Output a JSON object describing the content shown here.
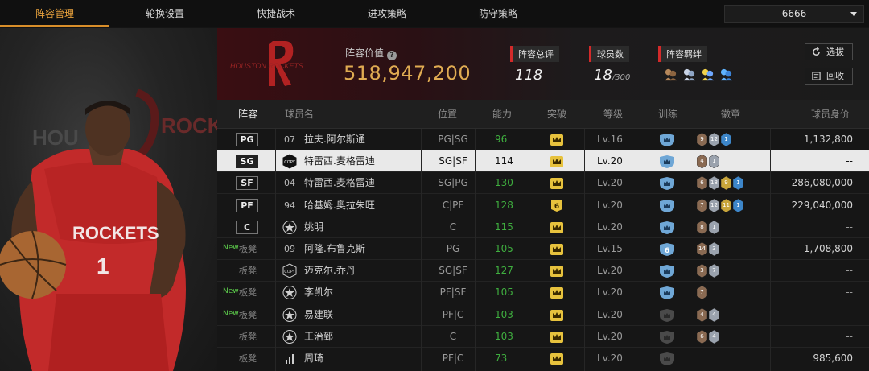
{
  "nav": {
    "tabs": [
      "阵容管理",
      "轮换设置",
      "快捷战术",
      "进攻策略",
      "防守策略"
    ],
    "server": "6666"
  },
  "header": {
    "team_logo_text": "HOUSTON ROCKETS",
    "value_label": "阵容价值",
    "value": "518,947,200",
    "overall_label": "阵容总评",
    "overall": "118",
    "players_label": "球员数",
    "players": "18",
    "players_max": "/300",
    "bonds_label": "阵容羁绊",
    "btn_select": "选拔",
    "btn_recycle": "回收"
  },
  "player_art": {
    "jersey_team": "ROCKETS",
    "jersey_number": "1",
    "bg_text_left": "HOU",
    "bg_text_right": "ROCK"
  },
  "table": {
    "headers": [
      "阵容",
      "球员名",
      "位置",
      "能力",
      "突破",
      "等级",
      "训练",
      "徽章",
      "球员身价"
    ],
    "rows": [
      {
        "slot": "PG",
        "bench": false,
        "new": false,
        "num": "07",
        "icon": "",
        "name": "拉夫.阿尔斯通",
        "pos": "PG|SG",
        "ability": "96",
        "breakthrough": "crown",
        "level": "Lv.16",
        "training": "blue",
        "badges": [
          [
            "9",
            "bronze"
          ],
          [
            "12",
            "silver"
          ],
          [
            "1",
            "blue"
          ]
        ],
        "price": "1,132,800"
      },
      {
        "slot": "SG",
        "bench": false,
        "new": false,
        "num": "",
        "icon": "COPY",
        "name": "特雷西.麦格雷迪",
        "pos": "SG|SF",
        "ability": "114",
        "breakthrough": "crown",
        "level": "Lv.20",
        "training": "blue",
        "badges": [
          [
            "4",
            "bronze"
          ],
          [
            "1",
            "silver"
          ]
        ],
        "price": "--",
        "selected": true
      },
      {
        "slot": "SF",
        "bench": false,
        "new": false,
        "num": "04",
        "icon": "",
        "name": "特雷西.麦格雷迪",
        "pos": "SG|PG",
        "ability": "130",
        "breakthrough": "crown",
        "level": "Lv.20",
        "training": "blue",
        "badges": [
          [
            "6",
            "bronze"
          ],
          [
            "18",
            "silver"
          ],
          [
            "9",
            "gold"
          ],
          [
            "1",
            "blue"
          ]
        ],
        "price": "286,080,000"
      },
      {
        "slot": "PF",
        "bench": false,
        "new": false,
        "num": "94",
        "icon": "",
        "name": "哈基姆.奥拉朱旺",
        "pos": "C|PF",
        "ability": "128",
        "breakthrough": "6",
        "level": "Lv.20",
        "training": "blue",
        "badges": [
          [
            "7",
            "bronze"
          ],
          [
            "12",
            "silver"
          ],
          [
            "11",
            "gold"
          ],
          [
            "1",
            "blue"
          ]
        ],
        "price": "229,040,000"
      },
      {
        "slot": "C",
        "bench": false,
        "new": false,
        "num": "",
        "icon": "star",
        "name": "姚明",
        "pos": "C",
        "ability": "115",
        "breakthrough": "crown",
        "level": "Lv.20",
        "training": "blue",
        "badges": [
          [
            "8",
            "bronze"
          ],
          [
            "1",
            "silver"
          ]
        ],
        "price": "--"
      },
      {
        "slot": "板凳",
        "bench": true,
        "new": true,
        "num": "09",
        "icon": "",
        "name": "阿隆.布鲁克斯",
        "pos": "PG",
        "ability": "105",
        "breakthrough": "crown",
        "level": "Lv.15",
        "training": "6",
        "badges": [
          [
            "14",
            "bronze"
          ],
          [
            "3",
            "silver"
          ]
        ],
        "price": "1,708,800"
      },
      {
        "slot": "板凳",
        "bench": true,
        "new": false,
        "num": "",
        "icon": "COPY",
        "name": "迈克尔.乔丹",
        "pos": "SG|SF",
        "ability": "127",
        "breakthrough": "crown",
        "level": "Lv.20",
        "training": "blue",
        "badges": [
          [
            "3",
            "bronze"
          ],
          [
            "7",
            "silver"
          ]
        ],
        "price": "--"
      },
      {
        "slot": "板凳",
        "bench": true,
        "new": true,
        "num": "",
        "icon": "star",
        "name": "李凯尔",
        "pos": "PF|SF",
        "ability": "105",
        "breakthrough": "crown",
        "level": "Lv.20",
        "training": "blue",
        "badges": [
          [
            "7",
            "bronze"
          ]
        ],
        "price": "--"
      },
      {
        "slot": "板凳",
        "bench": true,
        "new": true,
        "num": "",
        "icon": "star",
        "name": "易建联",
        "pos": "PF|C",
        "ability": "103",
        "breakthrough": "crown",
        "level": "Lv.20",
        "training": "grey",
        "badges": [
          [
            "4",
            "bronze"
          ],
          [
            "4",
            "silver"
          ]
        ],
        "price": "--"
      },
      {
        "slot": "板凳",
        "bench": true,
        "new": false,
        "num": "",
        "icon": "star",
        "name": "王治郅",
        "pos": "C",
        "ability": "103",
        "breakthrough": "crown",
        "level": "Lv.20",
        "training": "grey",
        "badges": [
          [
            "6",
            "bronze"
          ],
          [
            "4",
            "silver"
          ]
        ],
        "price": "--"
      },
      {
        "slot": "板凳",
        "bench": true,
        "new": false,
        "num": "",
        "icon": "bars",
        "name": "周琦",
        "pos": "PF|C",
        "ability": "73",
        "breakthrough": "crown",
        "level": "Lv.20",
        "training": "grey",
        "badges": [],
        "price": "985,600"
      }
    ]
  },
  "colors": {
    "accent": "#e6a03c",
    "ability_green": "#3fae3f",
    "value_gold": "#e0ac52",
    "new_green": "#5fd34d"
  }
}
